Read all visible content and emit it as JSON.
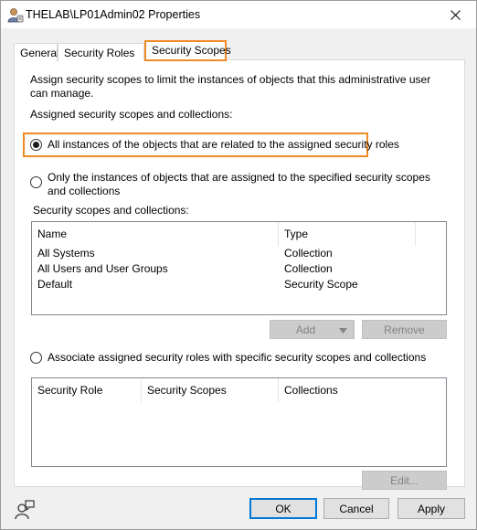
{
  "window": {
    "title": "THELAB\\LP01Admin02 Properties",
    "icon": "user-properties-icon",
    "close_icon": "close-icon"
  },
  "tabs": [
    {
      "label": "General",
      "active": false
    },
    {
      "label": "Security Roles",
      "active": false
    },
    {
      "label": "Security Scopes",
      "active": true
    }
  ],
  "panel": {
    "description": "Assign security scopes to limit the instances of objects that  this administrative user can manage.",
    "assigned_heading": "Assigned security scopes and collections:",
    "option_all_label": "All instances of the objects that are related to the assigned security roles",
    "option_all_selected": true,
    "option_only_label": "Only the instances of objects  that are assigned to the specified security scopes and collections",
    "option_only_selected": false,
    "scopes_heading": "Security scopes and collections:",
    "scopes_table": {
      "columns": [
        "Name",
        "Type"
      ],
      "rows": [
        {
          "name": "All Systems",
          "type": "Collection"
        },
        {
          "name": "All Users and User Groups",
          "type": "Collection"
        },
        {
          "name": "Default",
          "type": "Security Scope"
        }
      ]
    },
    "add_label": "Add",
    "remove_label": "Remove",
    "option_associate_label": "Associate assigned security roles with specific security scopes and collections",
    "option_associate_selected": false,
    "roles_table": {
      "columns": [
        "Security Role",
        "Security Scopes",
        "Collections"
      ]
    },
    "edit_label": "Edit..."
  },
  "footer": {
    "ok_label": "OK",
    "cancel_label": "Cancel",
    "apply_label": "Apply",
    "help_icon": "user-help-icon"
  },
  "colors": {
    "highlight": "#f08a24",
    "default_button_border": "#0078d7"
  }
}
